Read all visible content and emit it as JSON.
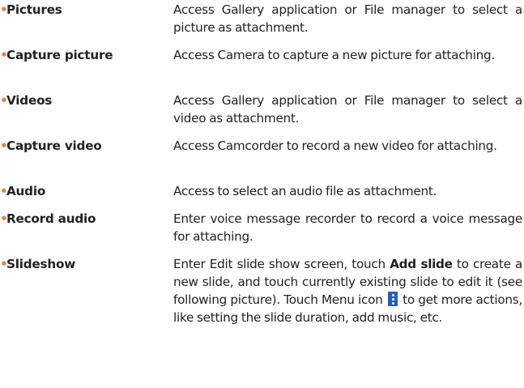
{
  "bullet_char": "•",
  "colors": {
    "bullet": "#e5843a",
    "text": "#222222",
    "menu_icon": "#2a5fb0"
  },
  "items": [
    {
      "term": "Pictures",
      "desc": "Access Gallery application or File manager to select a picture as attachment."
    },
    {
      "term": "Capture picture",
      "desc": "Access Camera to capture a new picture for attaching."
    },
    {
      "term": "Videos",
      "desc": "Access Gallery application or File manager to select a video as attachment."
    },
    {
      "term": "Capture video",
      "desc": "Access Camcorder to record a new video for attaching."
    },
    {
      "term": "Audio",
      "desc": "Access to select an audio file as attachment."
    },
    {
      "term": "Record audio",
      "desc": "Enter voice message recorder to record a voice message for attaching."
    },
    {
      "term": "Slideshow",
      "desc_part1": "Enter Edit slide show screen, touch ",
      "desc_bold": "Add slide",
      "desc_part2": " to create a new slide, and touch currently existing slide to edit it (see following picture). Touch Menu icon ",
      "desc_icon": "menu-icon",
      "desc_part3": " to get more actions, like setting the slide duration, add music, etc."
    }
  ]
}
